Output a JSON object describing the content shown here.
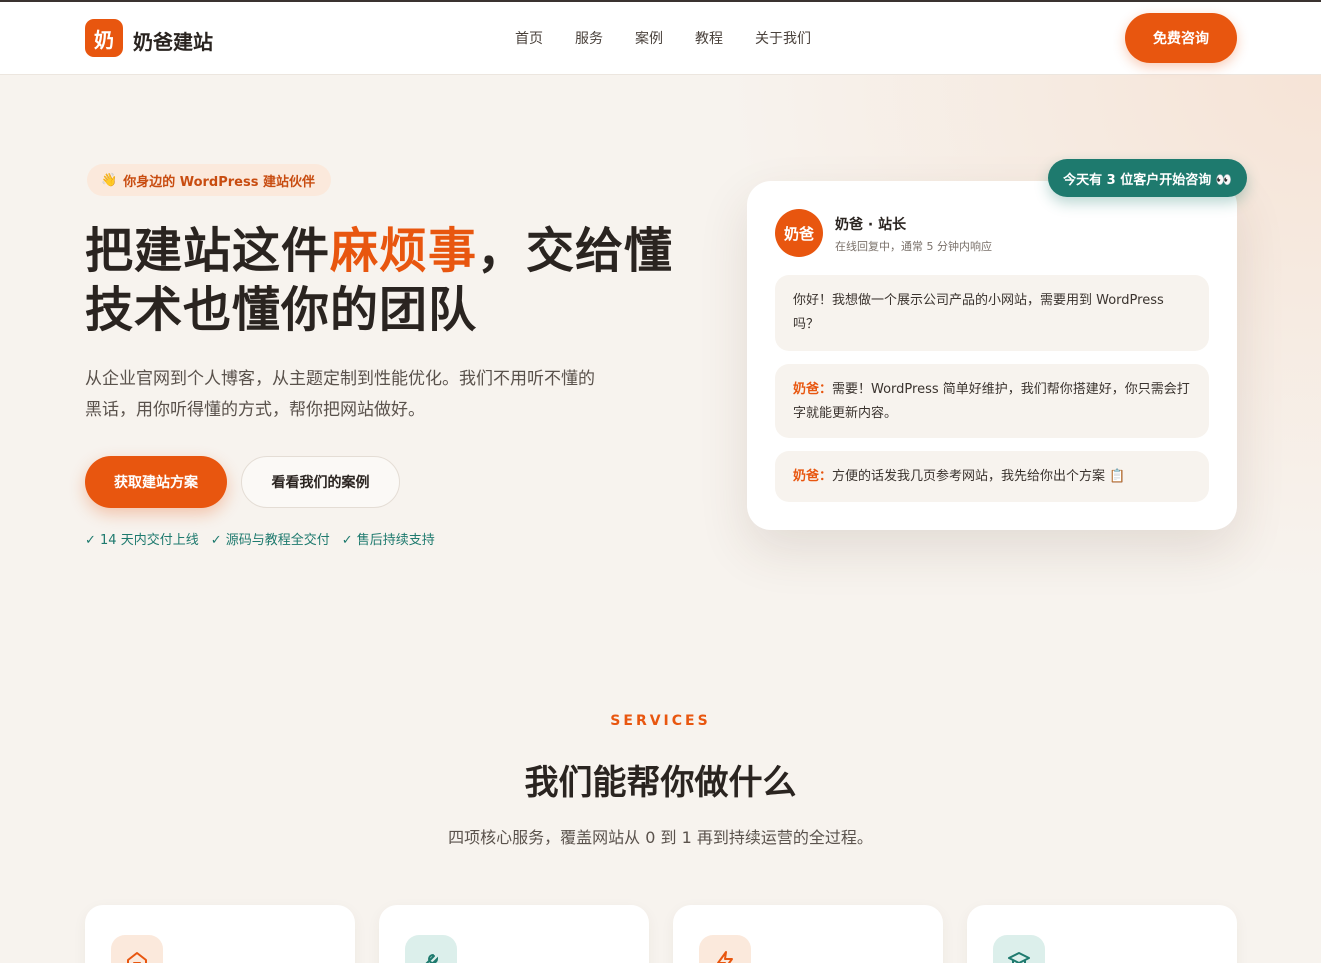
{
  "brand": {
    "logo_char": "奶",
    "name": "奶爸建站"
  },
  "nav": [
    "首页",
    "服务",
    "案例",
    "教程",
    "关于我们"
  ],
  "header_cta": "免费咨询",
  "hero": {
    "badge_icon": "👋",
    "badge_text": "你身边的 WordPress 建站伙伴",
    "title_part1": "把建站这件",
    "title_highlight": "麻烦事",
    "title_part2": "，交给懂技术也懂你的团队",
    "subtitle": "从企业官网到个人博客，从主题定制到性能优化。我们不用听不懂的黑话，用你听得懂的方式，帮你把网站做好。",
    "primary_button": "获取建站方案",
    "secondary_button": "看看我们的案例",
    "checks": [
      "✓ 14 天内交付上线",
      "✓ 源码与教程全交付",
      "✓ 售后持续支持"
    ]
  },
  "chat": {
    "floating_badge": "今天有 3 位客户开始咨询 👀",
    "avatar_text": "奶爸",
    "name": "奶爸 · 站长",
    "status": "在线回复中，通常 5 分钟内响应",
    "messages": [
      {
        "who": "",
        "text": "你好！我想做一个展示公司产品的小网站，需要用到 WordPress 吗？"
      },
      {
        "who": "奶爸：",
        "text": "需要！WordPress 简单好维护，我们帮你搭建好，你只需会打字就能更新内容。"
      },
      {
        "who": "奶爸：",
        "text": "方便的话发我几页参考网站，我先给你出个方案 📋"
      }
    ]
  },
  "services": {
    "label": "SERVICES",
    "title": "我们能帮你做什么",
    "subtitle": "四项核心服务，覆盖网站从 0 到 1 再到持续运营的全过程。",
    "cards": [
      {
        "icon": "home-icon",
        "accent": "#e8560f"
      },
      {
        "icon": "wrench-icon",
        "accent": "#1e7a6e"
      },
      {
        "icon": "lightning-icon",
        "accent": "#e8560f"
      },
      {
        "icon": "graduation-cap-icon",
        "accent": "#1e7a6e"
      }
    ]
  },
  "colors": {
    "accent": "#e8560f",
    "teal": "#1e7a6e",
    "background": "#f7f3ee"
  }
}
